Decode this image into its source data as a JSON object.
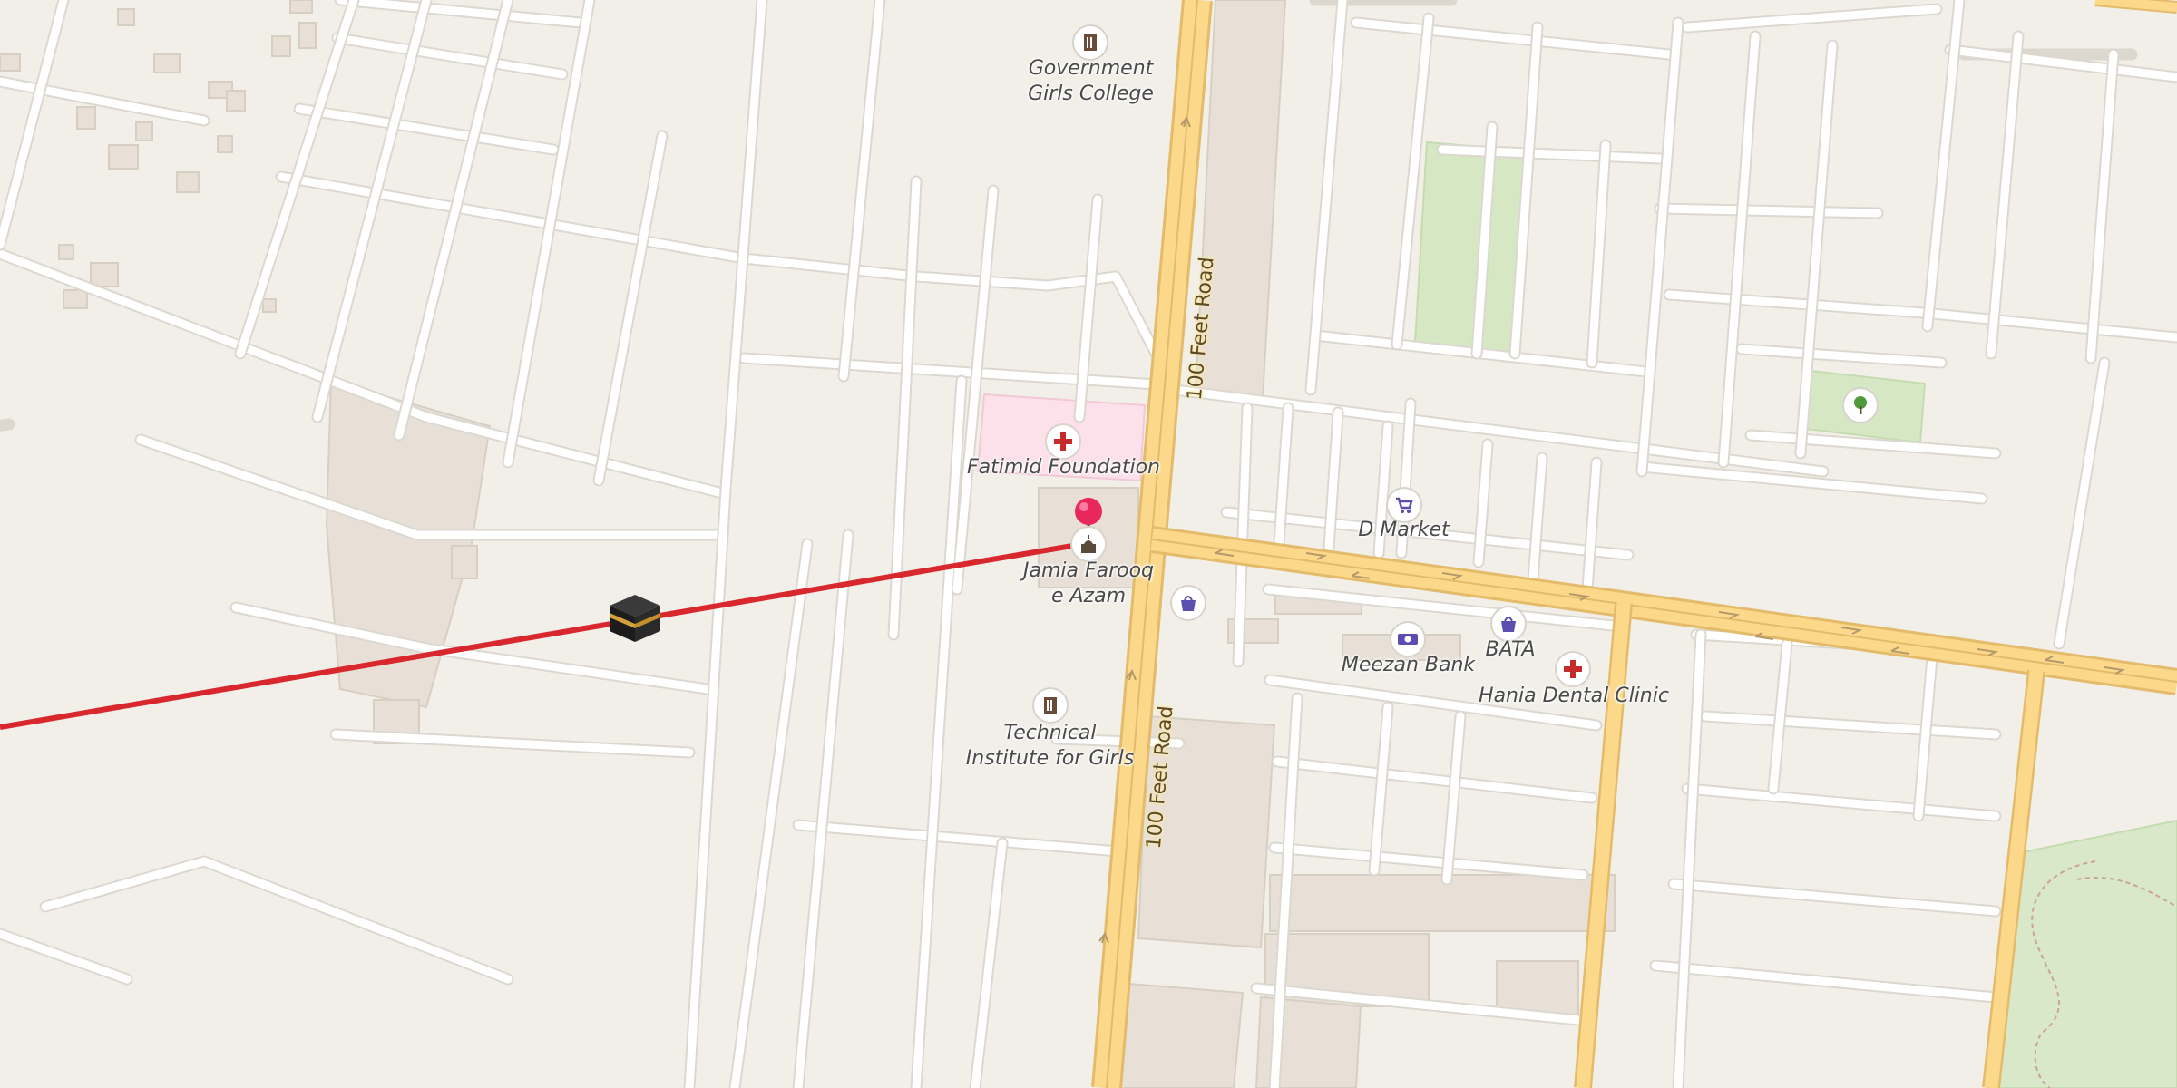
{
  "map": {
    "roads": [
      {
        "name": "100 Feet Road",
        "type": "secondary"
      },
      {
        "name": "100 Feet Road",
        "type": "secondary"
      }
    ],
    "places": [
      {
        "name": "Government\nGirls College",
        "category": "school",
        "icon": "school-icon"
      },
      {
        "name": "Fatimid Foundation",
        "category": "hospital",
        "icon": "medical-cross-icon"
      },
      {
        "name": "Jamia Farooq\ne Azam",
        "category": "mosque",
        "icon": "mosque-icon"
      },
      {
        "name": "D Market",
        "category": "supermarket",
        "icon": "shopping-cart-icon"
      },
      {
        "name": "Meezan Bank",
        "category": "bank",
        "icon": "banknote-icon"
      },
      {
        "name": "BATA",
        "category": "shoe shop",
        "icon": "shopping-bag-icon"
      },
      {
        "name": "Hania Dental Clinic",
        "category": "dentist",
        "icon": "medical-cross-icon"
      },
      {
        "name": "Technical\nInstitute for Girls",
        "category": "school",
        "icon": "school-icon"
      }
    ],
    "unnamed_pois": [
      {
        "category": "shop",
        "icon": "shopping-bag-icon"
      },
      {
        "category": "park",
        "icon": "tree-icon"
      }
    ],
    "markers": {
      "location_pin": {
        "icon": "location-pin-icon",
        "color": "#e8285c"
      },
      "qibla_marker": {
        "icon": "kaaba-icon"
      },
      "qibla_line": {
        "color": "#d9272e"
      }
    },
    "colors": {
      "background": "#f2efe9",
      "minor_road": "#ffffff",
      "road_casing": "#dcd8d0",
      "major_road": "#fcd98a",
      "major_road_casing": "#e3bb6a",
      "hospital_area": "#fde1ea",
      "park": "#d6e7c4",
      "building": "#e8e0d6"
    }
  }
}
